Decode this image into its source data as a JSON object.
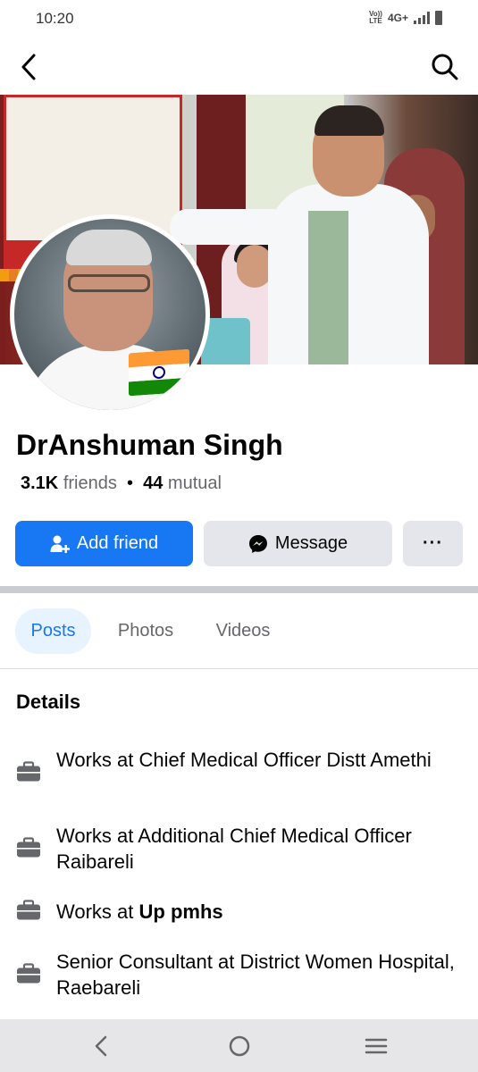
{
  "status_bar": {
    "time": "10:20",
    "volte_line1": "Vo))",
    "volte_line2": "LTE",
    "network": "4G+"
  },
  "top_bar": {
    "back_icon": "arrow-left-icon",
    "search_icon": "search-icon"
  },
  "profile": {
    "name": "DrAnshuman Singh",
    "friends_count": "3.1K",
    "friends_label": "friends",
    "separator": "•",
    "mutual_count": "44",
    "mutual_label": "mutual"
  },
  "actions": {
    "add_friend": "Add friend",
    "message": "Message",
    "more": "···"
  },
  "tabs": [
    {
      "label": "Posts",
      "active": true
    },
    {
      "label": "Photos",
      "active": false
    },
    {
      "label": "Videos",
      "active": false
    }
  ],
  "details": {
    "title": "Details",
    "items": [
      {
        "prefix": "Works at Chief Medical Officer Distt Amethi",
        "bold": ""
      },
      {
        "prefix": "Works at Additional Chief Medical Officer Raibareli",
        "bold": ""
      },
      {
        "prefix": "Works at ",
        "bold": "Up pmhs"
      },
      {
        "prefix": "Senior Consultant at District Women Hospital, Raebareli",
        "bold": ""
      }
    ],
    "icon": "briefcase-icon"
  },
  "colors": {
    "primary": "#1877f2",
    "tab_active_bg": "#e7f3ff",
    "secondary_button": "#e4e6eb",
    "text_secondary": "#65676b",
    "divider": "#c9ccd1"
  }
}
